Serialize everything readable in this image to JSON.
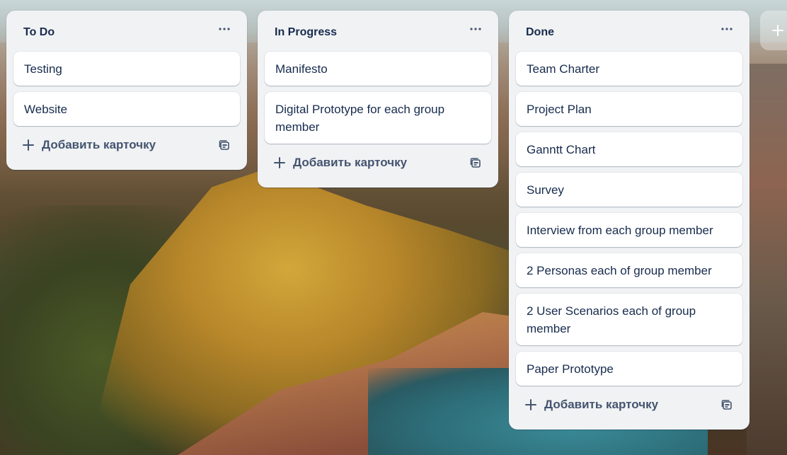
{
  "board": {
    "lists": [
      {
        "title": "To Do",
        "cards": [
          "Testing",
          "Website"
        ],
        "add_card_label": "Добавить карточку"
      },
      {
        "title": "In Progress",
        "cards": [
          "Manifesto",
          "Digital Prototype for each group member"
        ],
        "add_card_label": "Добавить карточку"
      },
      {
        "title": "Done",
        "cards": [
          "Team Charter",
          "Project Plan",
          "Ganntt Chart",
          "Survey",
          "Interview from each group member",
          "2 Personas each of group member",
          "2 User Scenarios each of group member",
          "Paper Prototype"
        ],
        "add_card_label": "Добавить карточку"
      }
    ]
  },
  "icons": {
    "list_menu": "more-horizontal-icon",
    "add": "plus-icon",
    "template": "card-template-icon"
  },
  "colors": {
    "list_bg": "#f1f2f4",
    "card_bg": "#ffffff",
    "text": "#172b4d",
    "muted_text": "#44546f"
  }
}
